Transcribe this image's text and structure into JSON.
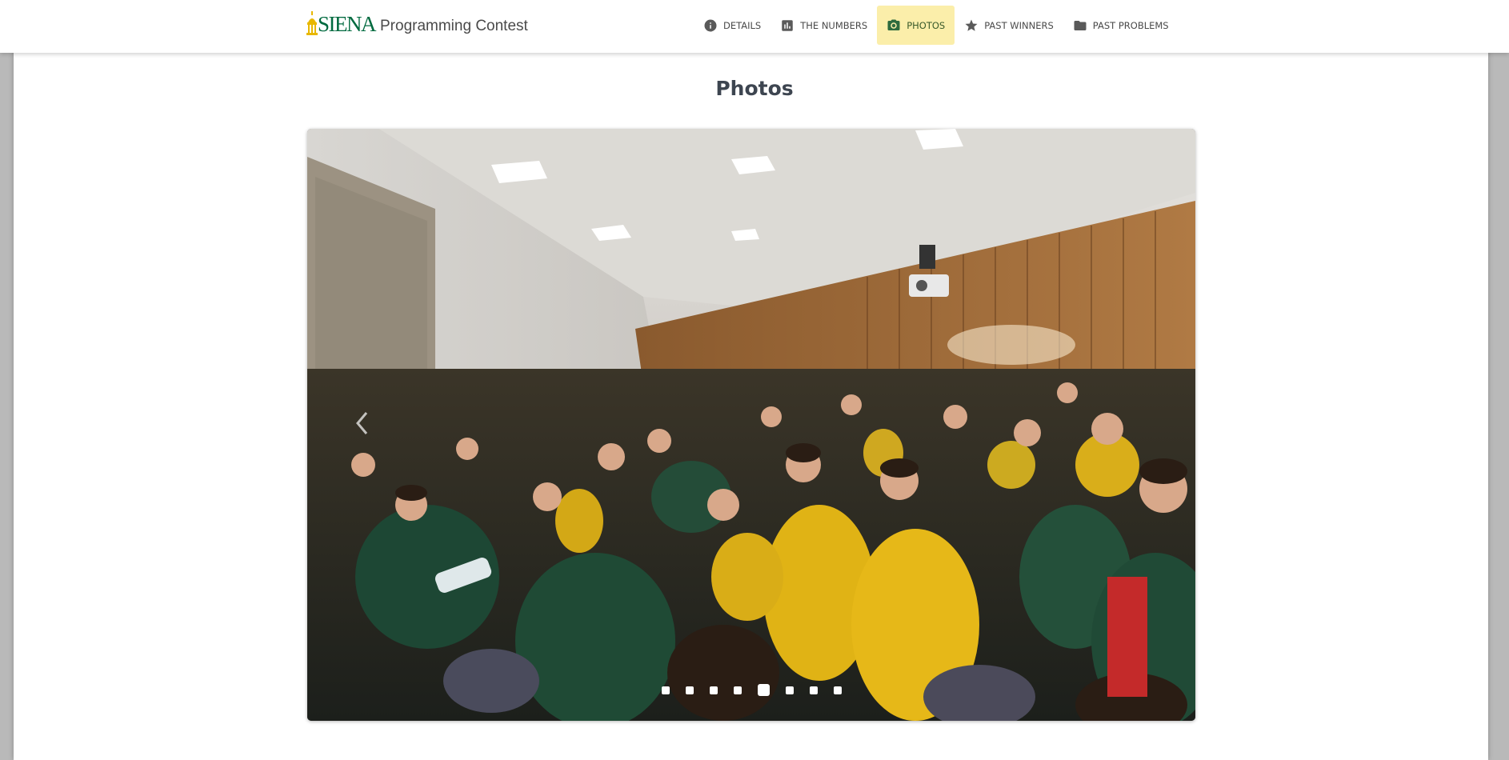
{
  "header": {
    "logo_text": "SIENA",
    "site_title": "Programming Contest",
    "brand_color": "#006a3f",
    "accent_color": "#fbeeaa",
    "nav": [
      {
        "label": "DETAILS",
        "icon": "info-icon"
      },
      {
        "label": "THE NUMBERS",
        "icon": "bar-chart-icon"
      },
      {
        "label": "PHOTOS",
        "icon": "camera-icon",
        "active": true
      },
      {
        "label": "PAST WINNERS",
        "icon": "star-icon"
      },
      {
        "label": "PAST PROBLEMS",
        "icon": "folder-icon"
      }
    ]
  },
  "main": {
    "page_title": "Photos",
    "carousel": {
      "slide_count": 8,
      "active_index": 4,
      "prev_icon": "chevron-left-icon"
    }
  }
}
